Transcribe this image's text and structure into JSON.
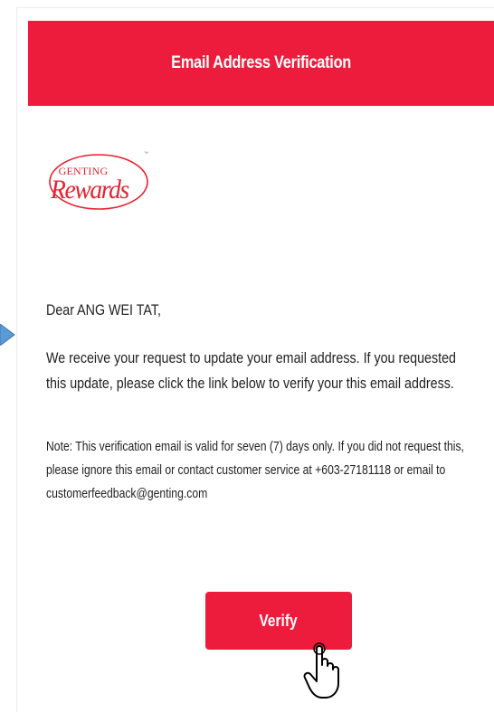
{
  "header": {
    "title": "Email Address Verification"
  },
  "logo": {
    "small_text": "GENTING",
    "big_text": "Rewards",
    "tm": "™"
  },
  "message": {
    "greeting": "Dear ANG WEI TAT,",
    "body": "We receive your request to update your email address. If you requested this update, please click the link below to verify your this email address.",
    "note": "Note: This verification email is valid for seven (7) days only. If you did not request this, please ignore this email or contact customer service at +603-27181118 or email to customerfeedback@genting.com"
  },
  "button": {
    "verify_label": "Verify"
  },
  "colors": {
    "brand_red": "#ee1c3c",
    "arrow_blue": "#5b9bd5"
  },
  "icons": {
    "pointer": "hand-pointer-icon",
    "arrow": "arrow-right-icon"
  }
}
